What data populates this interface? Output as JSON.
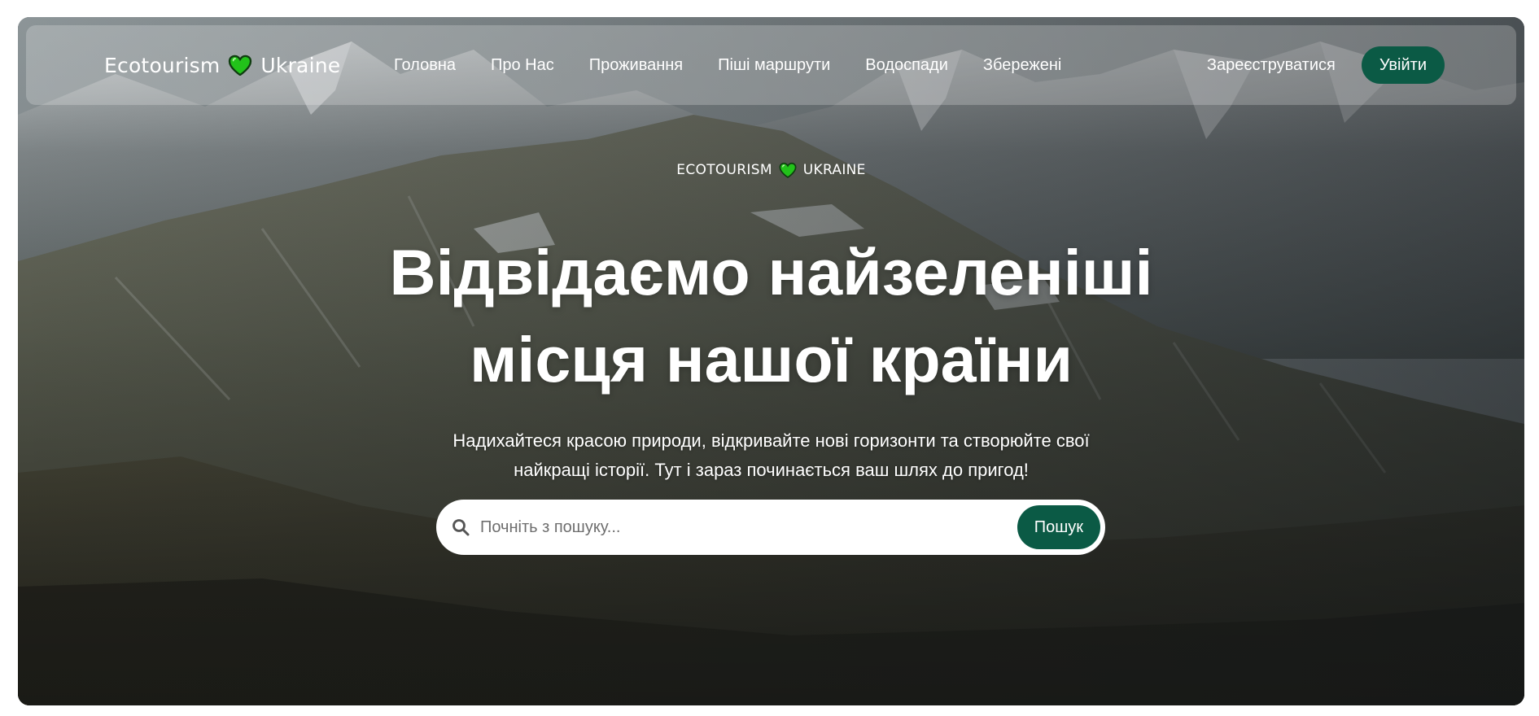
{
  "nav": {
    "logo_left": "Ecotourism",
    "logo_right": "Ukraine",
    "links": [
      "Головна",
      "Про Нас",
      "Проживання",
      "Піші маршрути",
      "Водоспади",
      "Збережені"
    ],
    "signup": "Зареєструватися",
    "login": "Увійти"
  },
  "hero": {
    "eyebrow_left": "ECOTOURISM",
    "eyebrow_right": "UKRAINE",
    "headline_line1": "Відвідаємо найзеленіші",
    "headline_line2": "місця нашої країни",
    "subtitle_line1": "Надихайтеся красою природи, відкривайте нові горизонти та створюйте свої",
    "subtitle_line2": "найкращі історії. Тут і зараз починається ваш шлях до пригод!"
  },
  "search": {
    "placeholder": "Почніть з пошуку...",
    "button": "Пошук"
  },
  "colors": {
    "accent": "#0b5a45",
    "heart": "#22c21a"
  },
  "icons": {
    "heart": "green-heart-icon",
    "search": "search-icon"
  }
}
